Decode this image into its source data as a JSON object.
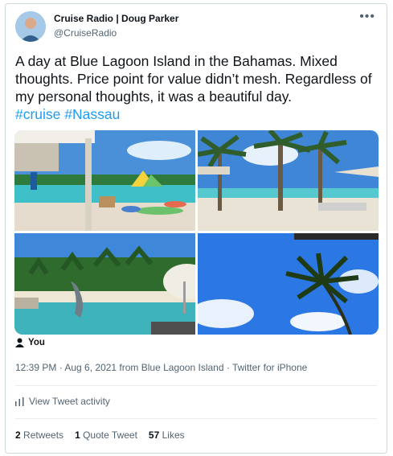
{
  "author": {
    "name": "Cruise Radio | Doug Parker",
    "handle": "@CruiseRadio"
  },
  "tweet": {
    "text": "A day at Blue Lagoon Island in the Bahamas. Mixed thoughts. Price point for value didn’t mesh. Regardless of my personal thoughts, it was a beautiful day.",
    "hashtags": [
      "#cruise",
      "#Nassau"
    ]
  },
  "media": {
    "photos": [
      "beach-waterpark",
      "palm-beach-cabanas",
      "dolphin-lagoon",
      "palm-sky"
    ]
  },
  "tagged": {
    "label": "You"
  },
  "meta": {
    "timestamp": "12:39 PM · Aug 6, 2021 from Blue Lagoon Island · Twitter for iPhone"
  },
  "activity": {
    "label": "View Tweet activity"
  },
  "stats": {
    "retweets": {
      "count": "2",
      "label": "Retweets"
    },
    "quotes": {
      "count": "1",
      "label": "Quote Tweet"
    },
    "likes": {
      "count": "57",
      "label": "Likes"
    }
  },
  "colors": {
    "link": "#1d9bf0",
    "muted": "#536471",
    "border": "#cfd9de"
  }
}
